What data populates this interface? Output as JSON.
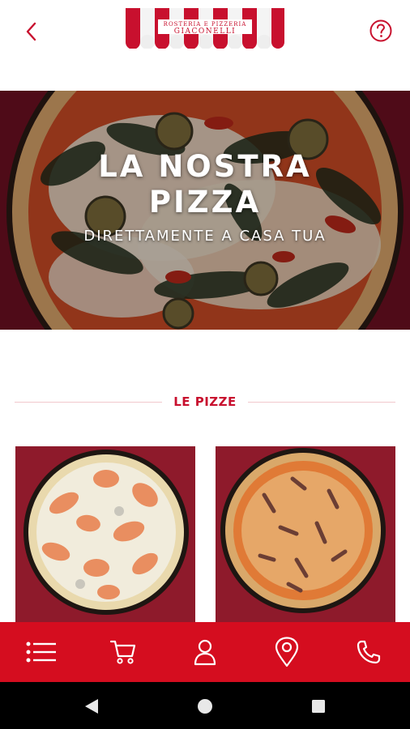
{
  "header": {
    "back_icon": "chevron-left-icon",
    "help_icon": "question-circle-icon",
    "logo": {
      "line1": "ROSTERIA E PIZZERIA",
      "line2": "GIACONELLI"
    }
  },
  "hero": {
    "title_line1": "LA NOSTRA",
    "title_line2": "PIZZA",
    "subtitle": "DIRETTAMENTE A CASA TUA"
  },
  "section": {
    "title": "LE PIZZE"
  },
  "products": [
    {
      "image": "salmon-pizza-photo"
    },
    {
      "image": "mushroom-ham-pizza-photo"
    }
  ],
  "bottom_nav": [
    {
      "icon": "menu-list-icon"
    },
    {
      "icon": "cart-icon"
    },
    {
      "icon": "user-icon"
    },
    {
      "icon": "map-pin-icon"
    },
    {
      "icon": "phone-icon"
    }
  ],
  "system_nav": [
    {
      "icon": "back-triangle-icon"
    },
    {
      "icon": "home-circle-icon"
    },
    {
      "icon": "recents-square-icon"
    }
  ],
  "colors": {
    "brand_red": "#d50d1f",
    "accent_red": "#c8102e",
    "divider_pink": "#f2c8cd",
    "background": "#ffffff"
  }
}
